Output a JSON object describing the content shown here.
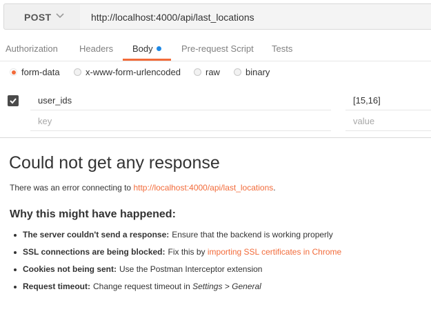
{
  "request": {
    "method": "POST",
    "url": "http://localhost:4000/api/last_locations"
  },
  "tabs": [
    {
      "label": "Authorization",
      "active": false
    },
    {
      "label": "Headers",
      "active": false
    },
    {
      "label": "Body",
      "active": true,
      "has_dot": true
    },
    {
      "label": "Pre-request Script",
      "active": false
    },
    {
      "label": "Tests",
      "active": false
    }
  ],
  "body_types": [
    {
      "label": "form-data",
      "selected": true
    },
    {
      "label": "x-www-form-urlencoded",
      "selected": false
    },
    {
      "label": "raw",
      "selected": false
    },
    {
      "label": "binary",
      "selected": false
    }
  ],
  "params": {
    "rows": [
      {
        "checked": true,
        "key": "user_ids",
        "value": "[15,16]"
      }
    ],
    "placeholder_key": "key",
    "placeholder_value": "value"
  },
  "response_error": {
    "title": "Could not get any response",
    "message_prefix": "There was an error connecting to ",
    "message_link": "http://localhost:4000/api/last_locations",
    "message_suffix": ".",
    "why_title": "Why this might have happened:",
    "reasons": [
      {
        "bold": "The server couldn't send a response:",
        "text": "Ensure that the backend is working properly"
      },
      {
        "bold": "SSL connections are being blocked:",
        "text": "Fix this by ",
        "link": "importing SSL certificates in Chrome"
      },
      {
        "bold": "Cookies not being sent:",
        "text": "Use the Postman Interceptor extension"
      },
      {
        "bold": "Request timeout:",
        "text": "Change request timeout in ",
        "italic": "Settings > General"
      }
    ]
  },
  "colors": {
    "accent": "#f26b3a",
    "dot_blue": "#1e88e5",
    "text": "#333333",
    "muted": "#808080"
  },
  "icons": {
    "method_dropdown": "chevron-down-icon",
    "row_checkbox": "checkmark-icon"
  }
}
